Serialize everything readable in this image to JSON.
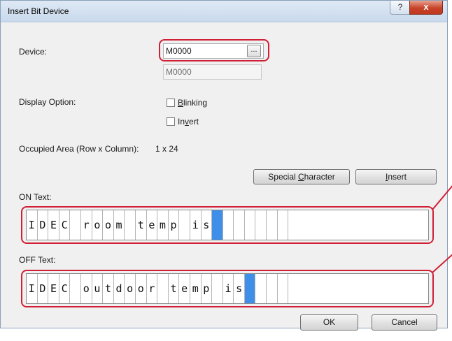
{
  "window": {
    "title": "Insert Bit Device",
    "help_glyph": "?",
    "close_glyph": "x"
  },
  "device": {
    "label": "Device:",
    "value": "M0000",
    "browse_label": "...",
    "comment_value": "M0000"
  },
  "display_option": {
    "label": "Display Option:",
    "blinking": {
      "pre": "",
      "accel": "B",
      "post": "linking",
      "checked": false
    },
    "invert": {
      "pre": "In",
      "accel": "v",
      "post": "ert",
      "checked": false
    }
  },
  "occupied": {
    "label": "Occupied Area (Row x Column):",
    "value": "1 x 24"
  },
  "buttons": {
    "special_pre": "Special ",
    "special_accel": "C",
    "special_post": "haracter",
    "insert_pre": "",
    "insert_accel": "I",
    "insert_post": "nsert",
    "ok": "OK",
    "cancel": "Cancel"
  },
  "on_text": {
    "label": "ON Text:",
    "cells": [
      "I",
      "D",
      "E",
      "C",
      " ",
      "r",
      "o",
      "o",
      "m",
      " ",
      "t",
      "e",
      "m",
      "p",
      " ",
      "i",
      "s",
      "",
      "",
      "",
      "",
      "",
      "",
      ""
    ],
    "cursor_index": 17
  },
  "off_text": {
    "label": "OFF Text:",
    "cells": [
      "I",
      "D",
      "E",
      "C",
      " ",
      "o",
      "u",
      "t",
      "d",
      "o",
      "o",
      "r",
      " ",
      "t",
      "e",
      "m",
      "p",
      " ",
      "i",
      "s",
      "",
      "",
      "",
      ""
    ],
    "cursor_index": 20
  },
  "colors": {
    "highlight": "#d12036",
    "cursor": "#3f8fe8"
  }
}
